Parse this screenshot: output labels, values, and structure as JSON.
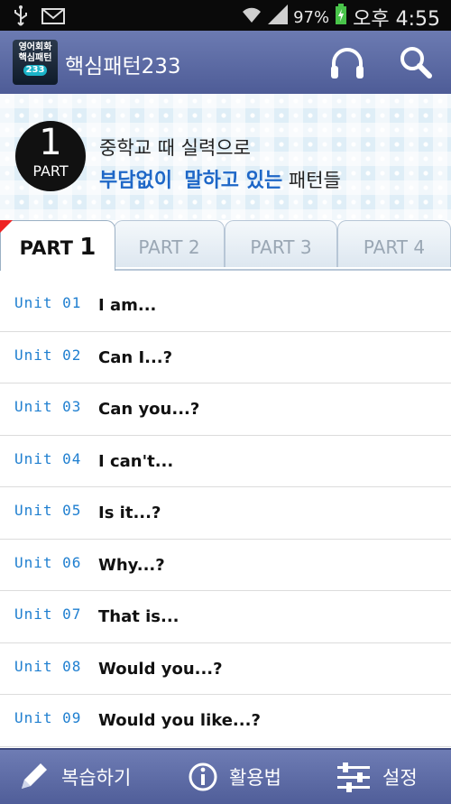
{
  "status_bar": {
    "battery_percent": "97%",
    "time": "오후 4:55"
  },
  "app_bar": {
    "icon_lines": [
      "영어회화",
      "핵심패턴",
      "233"
    ],
    "title": "핵심패턴233"
  },
  "banner": {
    "part_number": "1",
    "part_label": "PART",
    "line1": "중학교 때 실력으로",
    "highlight1": "부담없이",
    "highlight2": "말하고 있는",
    "line2_tail": "패턴들"
  },
  "tabs": [
    {
      "label": "PART",
      "num": "1",
      "active": true
    },
    {
      "label": "PART 2",
      "active": false
    },
    {
      "label": "PART 3",
      "active": false
    },
    {
      "label": "PART 4",
      "active": false
    }
  ],
  "units": [
    {
      "label": "Unit 01",
      "title": "I am..."
    },
    {
      "label": "Unit 02",
      "title": "Can I...?"
    },
    {
      "label": "Unit 03",
      "title": "Can you...?"
    },
    {
      "label": "Unit 04",
      "title": "I can't..."
    },
    {
      "label": "Unit 05",
      "title": "Is it...?"
    },
    {
      "label": "Unit 06",
      "title": "Why...?"
    },
    {
      "label": "Unit 07",
      "title": "That is..."
    },
    {
      "label": "Unit 08",
      "title": "Would you...?"
    },
    {
      "label": "Unit 09",
      "title": "Would you like...?"
    }
  ],
  "bottom_bar": {
    "review": "복습하기",
    "usage": "활용법",
    "settings": "설정"
  },
  "colors": {
    "accent_blue": "#1f7fd0",
    "appbar": "#5a68a4",
    "highlight": "#1e67c7"
  }
}
